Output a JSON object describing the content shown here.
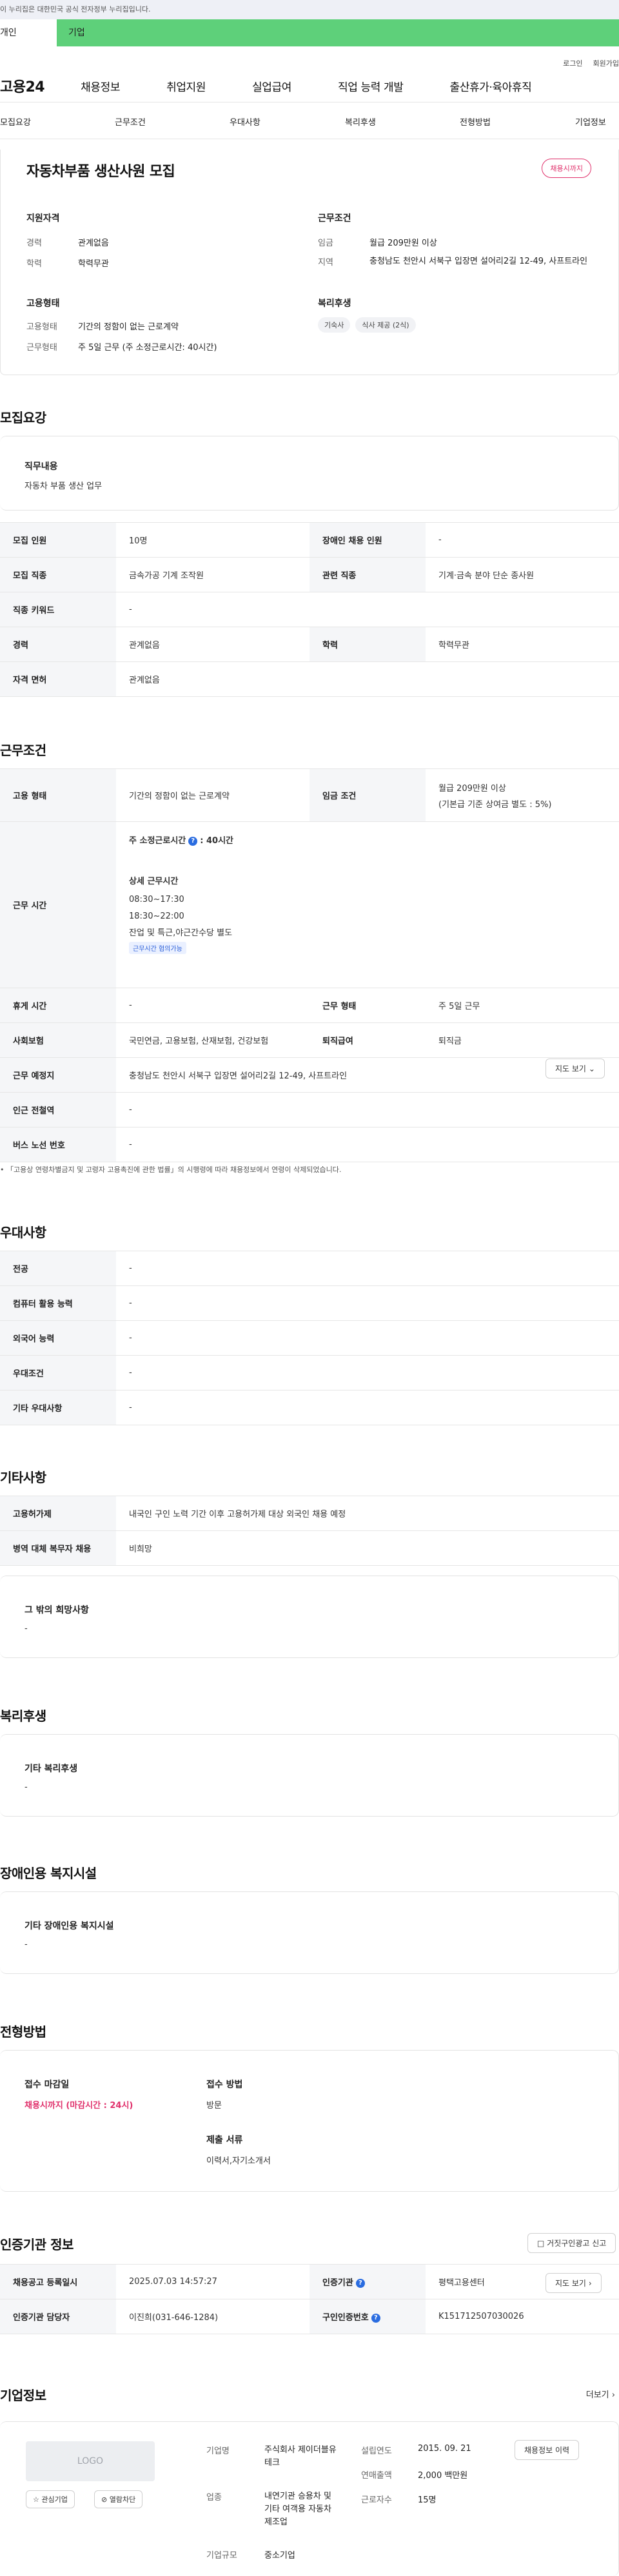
{
  "gov_banner": "이 누리집은 대한민국 공식 전자정부 누리집입니다.",
  "user_tabs": [
    "개인",
    "기업"
  ],
  "util_links": [
    "로그인",
    "회원가입"
  ],
  "logo": "고용24",
  "gnb": [
    "채용정보",
    "취업지원",
    "실업급여",
    "직업 능력 개발",
    "출산휴가·육아휴직"
  ],
  "subnav": [
    "모집요강",
    "근무조건",
    "우대사항",
    "복리후생",
    "전형방법",
    "기업정보"
  ],
  "summary": {
    "title": "자동차부품 생산사원 모집",
    "deadline_badge": "채용시까지",
    "qual_head": "지원자격",
    "qual": [
      {
        "k": "경력",
        "v": "관계없음"
      },
      {
        "k": "학력",
        "v": "학력무관"
      }
    ],
    "cond_head": "근무조건",
    "cond": [
      {
        "k": "임금",
        "v": "월급 209만원 이상"
      },
      {
        "k": "지역",
        "v": "충청남도 천안시 서북구 입장면 설어리2길 12-49, 사프트라인"
      }
    ],
    "emp_head": "고용형태",
    "emp": [
      {
        "k": "고용형태",
        "v": "기간의 정함이 없는 근로계약"
      },
      {
        "k": "근무형태",
        "v": "주 5일 근무 (주 소정근로시간: 40시간)"
      }
    ],
    "welfare_head": "복리후생",
    "welfare_chips": [
      "기숙사",
      "식사 제공 (2식)"
    ]
  },
  "recruit": {
    "heading": "모집요강",
    "duty_title": "직무내용",
    "duty_value": "자동차 부품 생산 업무",
    "rows": [
      {
        "k1": "모집 인원",
        "v1": "10명",
        "k2": "장애인 채용 인원",
        "v2": "-"
      },
      {
        "k1": "모집 직종",
        "v1": "금속가공 기계 조작원",
        "k2": "관련 직종",
        "v2": "기계·금속 분야 단순 종사원"
      },
      {
        "k1": "직종 키워드",
        "v1": "-"
      },
      {
        "k1": "경력",
        "v1": "관계없음",
        "k2": "학력",
        "v2": "학력무관"
      },
      {
        "k1": "자격 면허",
        "v1": "관계없음"
      }
    ]
  },
  "work": {
    "heading": "근무조건",
    "emp_type_k": "고용 형태",
    "emp_type_v": "기간의 정함이 없는 근로계약",
    "wage_k": "임금 조건",
    "wage_v1": "월급 209만원 이상",
    "wage_v2": "(기본급 기준 상여금 별도 : 5%)",
    "hours_k": "근무 시간",
    "hours_weekly": "주 소정근로시간",
    "hours_weekly_v": ": 40시간",
    "hours_detail_title": "상세 근무시간",
    "hours_detail": [
      "08:30~17:30",
      "18:30~22:00",
      "잔업 및 특근,야근간수당 별도"
    ],
    "hours_tag": "근무시간 협의가능",
    "rest_k": "휴게 시간",
    "rest_v": "-",
    "shape_k": "근무 형태",
    "shape_v": "주 5일 근무",
    "ins_k": "사회보험",
    "ins_v": "국민연금, 고용보험, 산재보험, 건강보험",
    "ret_k": "퇴직급여",
    "ret_v": "퇴직금",
    "place_k": "근무 예정지",
    "place_v": "충청남도 천안시 서북구 입장면 설어리2길 12-49, 사프트라인",
    "map_btn": "지도 보기",
    "subway_k": "인근 전철역",
    "subway_v": "-",
    "bus_k": "버스 노선 번호",
    "bus_v": "-",
    "notice": "「고용상 연령차별금지 및 고령자 고용촉진에 관한 법률」의 시행령에 따라 채용정보에서 연령이 삭제되었습니다."
  },
  "pref": {
    "heading": "우대사항",
    "rows": [
      {
        "k": "전공",
        "v": "-"
      },
      {
        "k": "컴퓨터 활용 능력",
        "v": "-"
      },
      {
        "k": "외국어 능력",
        "v": "-"
      },
      {
        "k": "우대조건",
        "v": "-"
      },
      {
        "k": "기타 우대사항",
        "v": "-"
      }
    ]
  },
  "etc": {
    "heading": "기타사항",
    "rows": [
      {
        "k": "고용허가제",
        "v": "내국인 구인 노력 기간 이후 고용허가제 대상 외국인 채용 예정"
      },
      {
        "k": "병역 대체 복무자 채용",
        "v": "비희망"
      }
    ],
    "other_title": "그 밖의 희망사항",
    "other_value": "-"
  },
  "welfare": {
    "heading": "복리후생",
    "title": "기타 복리후생",
    "value": "-"
  },
  "disability": {
    "heading": "장애인용 복지시설",
    "title": "기타 장애인용 복지시설",
    "value": "-"
  },
  "selection": {
    "heading": "전형방법",
    "deadline_k": "접수 마감일",
    "deadline_v": "채용시까지 (마감시간 : 24시)",
    "method_k": "접수 방법",
    "method_v": "방문",
    "docs_k": "제출 서류",
    "docs_v": "이력서,자기소개서"
  },
  "agency": {
    "heading": "인증기관 정보",
    "report_btn": "거짓구인광고 신고",
    "rows": [
      {
        "k1": "채용공고 등록일시",
        "v1": "2025.07.03 14:57:27",
        "k2": "인증기관",
        "v2": "평택고용센터"
      },
      {
        "k1": "인증기관 담당자",
        "v1": "이진희(031-646-1284)",
        "k2": "구인인증번호",
        "v2": "K151712507030026"
      }
    ],
    "map_btn": "지도 보기"
  },
  "company": {
    "heading": "기업정보",
    "more": "더보기",
    "logo": "LOGO",
    "fav_btn": "관심기업",
    "block_btn": "열람차단",
    "name_k": "기업명",
    "name_v": "주식회사 제이더블유테크",
    "ind_k": "업종",
    "ind_v": "내연기관 승용차 및 기타 여객용 자동차 제조업",
    "size_k": "기업규모",
    "size_v": "중소기업",
    "est_k": "설립연도",
    "est_v": "2015. 09. 21",
    "sales_k": "연매출액",
    "sales_v": "2,000 백만원",
    "emp_k": "근로자수",
    "emp_v": "15명",
    "history_btn": "채용정보 이력"
  },
  "colors": {
    "accent_green": "#5ed07a",
    "deadline_pink": "#e0306b",
    "info_blue": "#2a6ce0"
  }
}
